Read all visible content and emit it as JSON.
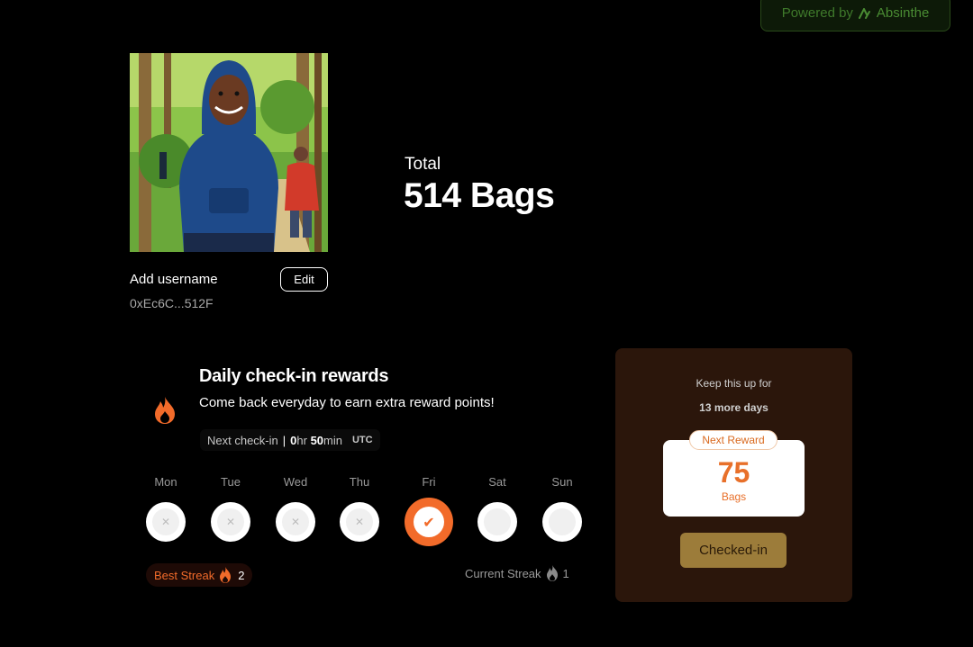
{
  "badge": {
    "prefix": "Powered by",
    "brand": "Absinthe"
  },
  "profile": {
    "username": "Add username",
    "edit_label": "Edit",
    "address": "0xEc6C...512F"
  },
  "total": {
    "label": "Total",
    "value": "514 Bags"
  },
  "checkin": {
    "title": "Daily check-in rewards",
    "subtitle": "Come back everyday to earn extra reward points!",
    "next_label": "Next check-in",
    "hours_value": "0",
    "hours_unit": "hr",
    "minutes_value": "50",
    "minutes_unit": "min",
    "timezone": "UTC",
    "days": [
      {
        "label": "Mon",
        "state": "missed",
        "mark": "✕"
      },
      {
        "label": "Tue",
        "state": "missed",
        "mark": "✕"
      },
      {
        "label": "Wed",
        "state": "missed",
        "mark": "✕"
      },
      {
        "label": "Thu",
        "state": "missed",
        "mark": "✕"
      },
      {
        "label": "Fri",
        "state": "checked",
        "mark": "✔"
      },
      {
        "label": "Sat",
        "state": "upcoming",
        "mark": ""
      },
      {
        "label": "Sun",
        "state": "upcoming",
        "mark": ""
      }
    ],
    "best_streak_label": "Best Streak",
    "best_streak_value": "2",
    "current_streak_label": "Current Streak",
    "current_streak_value": "1"
  },
  "reward": {
    "keep_text": "Keep this up for",
    "days_text": "13 more days",
    "tag": "Next Reward",
    "amount": "75",
    "unit": "Bags",
    "button_label": "Checked-in"
  },
  "colors": {
    "accent": "#f26b2a",
    "panel": "#2b160b",
    "button": "#9c7c3a",
    "badge_bg": "#0d1a08",
    "badge_text": "#4a8c33"
  }
}
